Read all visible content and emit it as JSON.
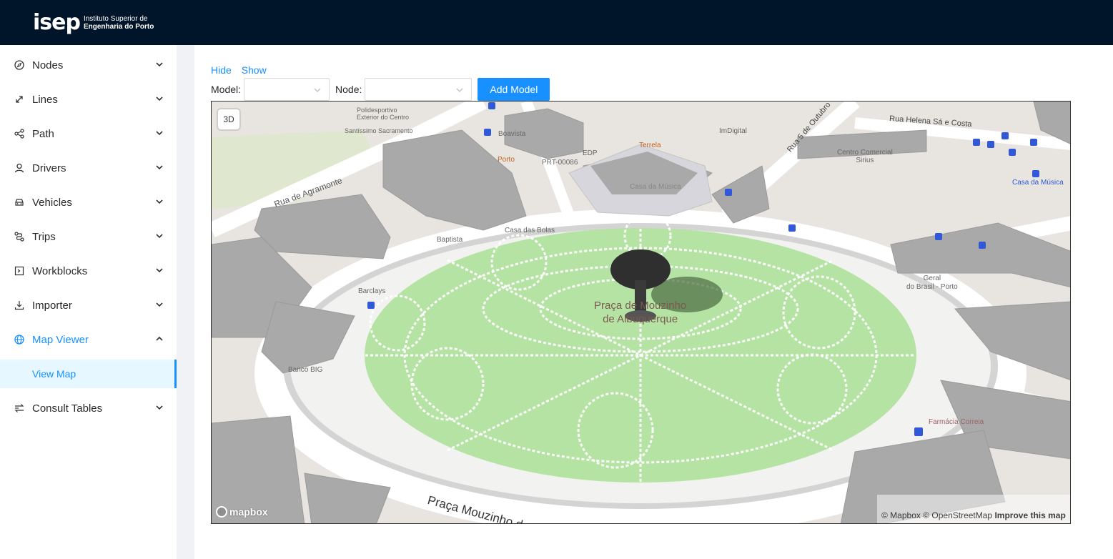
{
  "header": {
    "logo_text": "isep",
    "logo_sub_line1": "Instituto Superior de",
    "logo_sub_line2": "Engenharia do Porto"
  },
  "sidebar": {
    "items": [
      {
        "label": "Nodes",
        "icon": "compass-icon"
      },
      {
        "label": "Lines",
        "icon": "arrows-expand-icon"
      },
      {
        "label": "Path",
        "icon": "share-icon"
      },
      {
        "label": "Drivers",
        "icon": "user-icon"
      },
      {
        "label": "Vehicles",
        "icon": "car-icon"
      },
      {
        "label": "Trips",
        "icon": "route-icon"
      },
      {
        "label": "Workblocks",
        "icon": "code-icon"
      },
      {
        "label": "Importer",
        "icon": "download-icon"
      },
      {
        "label": "Map Viewer",
        "icon": "globe-icon"
      },
      {
        "label": "Consult Tables",
        "icon": "swap-icon"
      }
    ],
    "submenu": {
      "label": "View Map"
    }
  },
  "toolbar": {
    "hide_label": "Hide",
    "show_label": "Show",
    "model_label": "Model:",
    "node_label": "Node:",
    "add_model_label": "Add Model"
  },
  "map": {
    "btn_3d": "3D",
    "logo_text": "mapbox",
    "attribution_mapbox": "© Mapbox",
    "attribution_osm": "© OpenStreetMap",
    "improve": "Improve this map",
    "labels": {
      "square_l1": "Praça de Mouzinho",
      "square_l2": "de Albuquerque",
      "street_main": "Praça Mouzinho de Albuquerque",
      "rua_agramonte": "Rua de Agramonte",
      "rua_5_outubro": "Rua 5 de Outubro",
      "rua_helena": "Rua Helena Sá e Costa",
      "centro_comercial_l1": "Centro Comercial",
      "centro_comercial_l2": "Sirius",
      "casa_musica": "Casa da Música",
      "casa_bolas": "Casa das Bolas",
      "barclays": "Barclays",
      "banco_big": "Banco BIG",
      "banco_brasil_l1": "Geral",
      "banco_brasil_l2": "do Brasil - Porto",
      "farmacia": "Farmácia Correia",
      "imdigital": "ImDigital",
      "terrela": "Terrela",
      "edp": "EDP",
      "prt": "PRT-00086",
      "boavista": "Boavista",
      "porto": "Porto",
      "polidesportivo_l1": "Polidesportivo",
      "polidesportivo_l2": "Exterior do Centro",
      "santissimo": "Santíssimo Sacramento",
      "baptista": "Baptista",
      "casa_musica_plaza": "Casa da Música"
    }
  },
  "colors": {
    "header_bg": "#001529",
    "accent": "#1890ff",
    "park_green": "#b5e3a3",
    "building_gray": "#a9a9a9"
  }
}
